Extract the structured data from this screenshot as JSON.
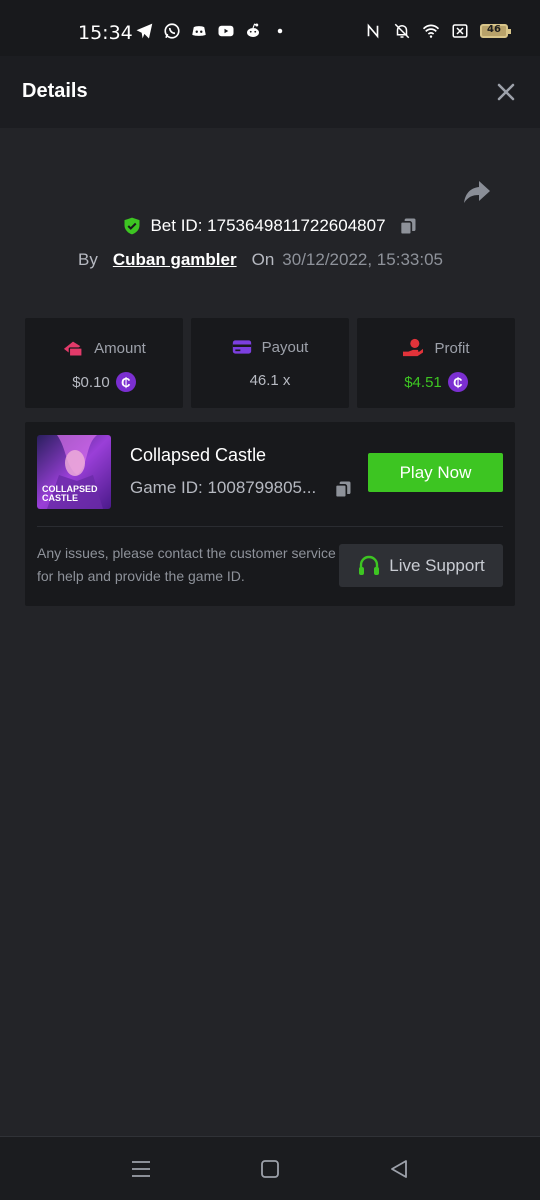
{
  "status_bar": {
    "time": "15:34",
    "battery_level": "46",
    "icons_left": [
      "telegram-icon",
      "whatsapp-icon",
      "discord-icon",
      "youtube-icon",
      "reddit-icon",
      "dot-icon"
    ],
    "icons_right": [
      "nfc-icon",
      "mute-icon",
      "wifi-icon",
      "x-box-icon",
      "battery-icon"
    ]
  },
  "header": {
    "title": "Details"
  },
  "bet": {
    "bet_id_label": "Bet ID: 1753649811722604807",
    "by_label": "By",
    "username": "Cuban gambler",
    "on_label": "On",
    "datetime": "30/12/2022, 15:33:05"
  },
  "stats": {
    "amount": {
      "label": "Amount",
      "value": "$0.10",
      "coin": "₵"
    },
    "payout": {
      "label": "Payout",
      "value": "46.1 x"
    },
    "profit": {
      "label": "Profit",
      "value": "$4.51",
      "coin": "₵"
    }
  },
  "game": {
    "name": "Collapsed Castle",
    "game_id": "Game ID: 1008799805...",
    "thumb_text_line1": "COLLAPSED",
    "thumb_text_line2": "CASTLE",
    "play_label": "Play Now",
    "issue_text": "Any issues, please contact the customer service for help and provide the game ID.",
    "support_label": "Live Support"
  },
  "colors": {
    "background": "#232428",
    "card": "#18191c",
    "accent_green": "#3dc522",
    "profit_green": "#3dc522",
    "coin_purple": "#7b2fd1",
    "amount_icon": "#e23a6a",
    "payout_icon": "#7c3fe0",
    "profit_icon": "#e2333a"
  }
}
